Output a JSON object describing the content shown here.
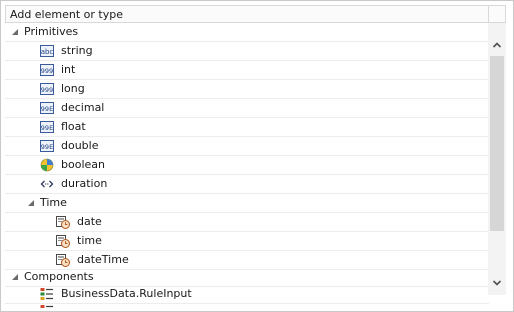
{
  "header": {
    "title": "Add element or type"
  },
  "tree": {
    "primitives": {
      "label": "Primitives",
      "items": [
        {
          "label": "string",
          "icon": "abc-type-icon"
        },
        {
          "label": "int",
          "icon": "999-type-icon"
        },
        {
          "label": "long",
          "icon": "999-type-icon"
        },
        {
          "label": "decimal",
          "icon": "99e-type-icon"
        },
        {
          "label": "float",
          "icon": "99e-type-icon"
        },
        {
          "label": "double",
          "icon": "99e-type-icon"
        },
        {
          "label": "boolean",
          "icon": "boolean-type-icon"
        },
        {
          "label": "duration",
          "icon": "duration-type-icon"
        }
      ]
    },
    "time": {
      "label": "Time",
      "items": [
        {
          "label": "date",
          "icon": "calendar-clock-icon"
        },
        {
          "label": "time",
          "icon": "calendar-clock-icon"
        },
        {
          "label": "dateTime",
          "icon": "calendar-clock-icon"
        }
      ]
    },
    "components": {
      "label": "Components",
      "items": [
        {
          "label": "BusinessData.RuleInput",
          "icon": "business-object-icon"
        }
      ]
    }
  }
}
